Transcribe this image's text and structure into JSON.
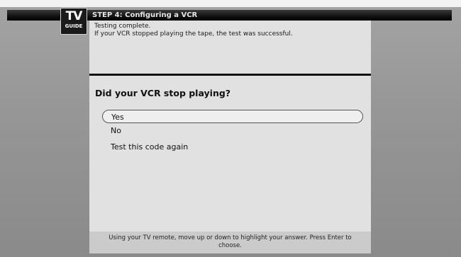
{
  "header": {
    "logo_top": "TV",
    "logo_bottom": "GUIDE",
    "title": "STEP 4: Configuring a VCR"
  },
  "info": {
    "line1": "Testing complete.",
    "line2": "If your VCR stopped playing the tape, the test was successful."
  },
  "question": "Did your VCR stop playing?",
  "options": [
    {
      "label": "Yes",
      "selected": true
    },
    {
      "label": "No",
      "selected": false
    },
    {
      "label": "Test this code again",
      "selected": false
    }
  ],
  "footer": "Using your TV remote, move up or down to highlight your answer.  Press Enter to choose."
}
